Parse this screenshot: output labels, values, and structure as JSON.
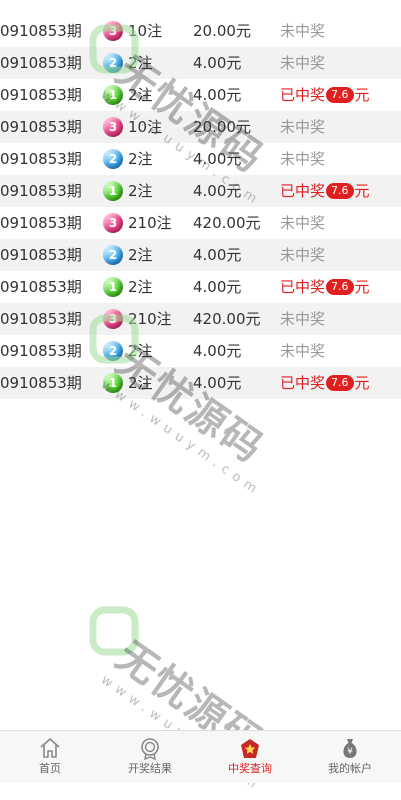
{
  "rows": [
    {
      "issue": "0910853期",
      "ball": "3",
      "ball_color": "pink",
      "bets": "10注",
      "amount": "20.00元",
      "status": "未中奖",
      "won": false,
      "prize": ""
    },
    {
      "issue": "0910853期",
      "ball": "2",
      "ball_color": "blue",
      "bets": "2注",
      "amount": "4.00元",
      "status": "未中奖",
      "won": false,
      "prize": ""
    },
    {
      "issue": "0910853期",
      "ball": "1",
      "ball_color": "green",
      "bets": "2注",
      "amount": "4.00元",
      "status": "已中奖",
      "won": true,
      "prize": "7.6",
      "unit": "元"
    },
    {
      "issue": "0910853期",
      "ball": "3",
      "ball_color": "pink",
      "bets": "10注",
      "amount": "20.00元",
      "status": "未中奖",
      "won": false,
      "prize": ""
    },
    {
      "issue": "0910853期",
      "ball": "2",
      "ball_color": "blue",
      "bets": "2注",
      "amount": "4.00元",
      "status": "未中奖",
      "won": false,
      "prize": ""
    },
    {
      "issue": "0910853期",
      "ball": "1",
      "ball_color": "green",
      "bets": "2注",
      "amount": "4.00元",
      "status": "已中奖",
      "won": true,
      "prize": "7.6",
      "unit": "元"
    },
    {
      "issue": "0910853期",
      "ball": "3",
      "ball_color": "pink",
      "bets": "210注",
      "amount": "420.00元",
      "status": "未中奖",
      "won": false,
      "prize": ""
    },
    {
      "issue": "0910853期",
      "ball": "2",
      "ball_color": "blue",
      "bets": "2注",
      "amount": "4.00元",
      "status": "未中奖",
      "won": false,
      "prize": ""
    },
    {
      "issue": "0910853期",
      "ball": "1",
      "ball_color": "green",
      "bets": "2注",
      "amount": "4.00元",
      "status": "已中奖",
      "won": true,
      "prize": "7.6",
      "unit": "元"
    },
    {
      "issue": "0910853期",
      "ball": "3",
      "ball_color": "pink",
      "bets": "210注",
      "amount": "420.00元",
      "status": "未中奖",
      "won": false,
      "prize": ""
    },
    {
      "issue": "0910853期",
      "ball": "2",
      "ball_color": "blue",
      "bets": "2注",
      "amount": "4.00元",
      "status": "未中奖",
      "won": false,
      "prize": ""
    },
    {
      "issue": "0910853期",
      "ball": "1",
      "ball_color": "green",
      "bets": "2注",
      "amount": "4.00元",
      "status": "已中奖",
      "won": true,
      "prize": "7.6",
      "unit": "元"
    }
  ],
  "colors": {
    "pink": "#ee3f86",
    "blue": "#3aa8ee",
    "green": "#4fcf2a",
    "won_red": "#e02020",
    "muted_gray": "#999999",
    "watermark_green": "#9ddc98"
  },
  "tabbar": {
    "tabs": [
      {
        "label": "首页",
        "icon": "home-icon",
        "active": false
      },
      {
        "label": "开奖结果",
        "icon": "award-medal-icon",
        "active": false
      },
      {
        "label": "中奖查询",
        "icon": "prize-query-icon",
        "active": true
      },
      {
        "label": "我的帐户",
        "icon": "money-bag-icon",
        "active": false
      }
    ]
  },
  "watermark": {
    "brand": "无忧源码",
    "url": "www.wuuym.com"
  }
}
